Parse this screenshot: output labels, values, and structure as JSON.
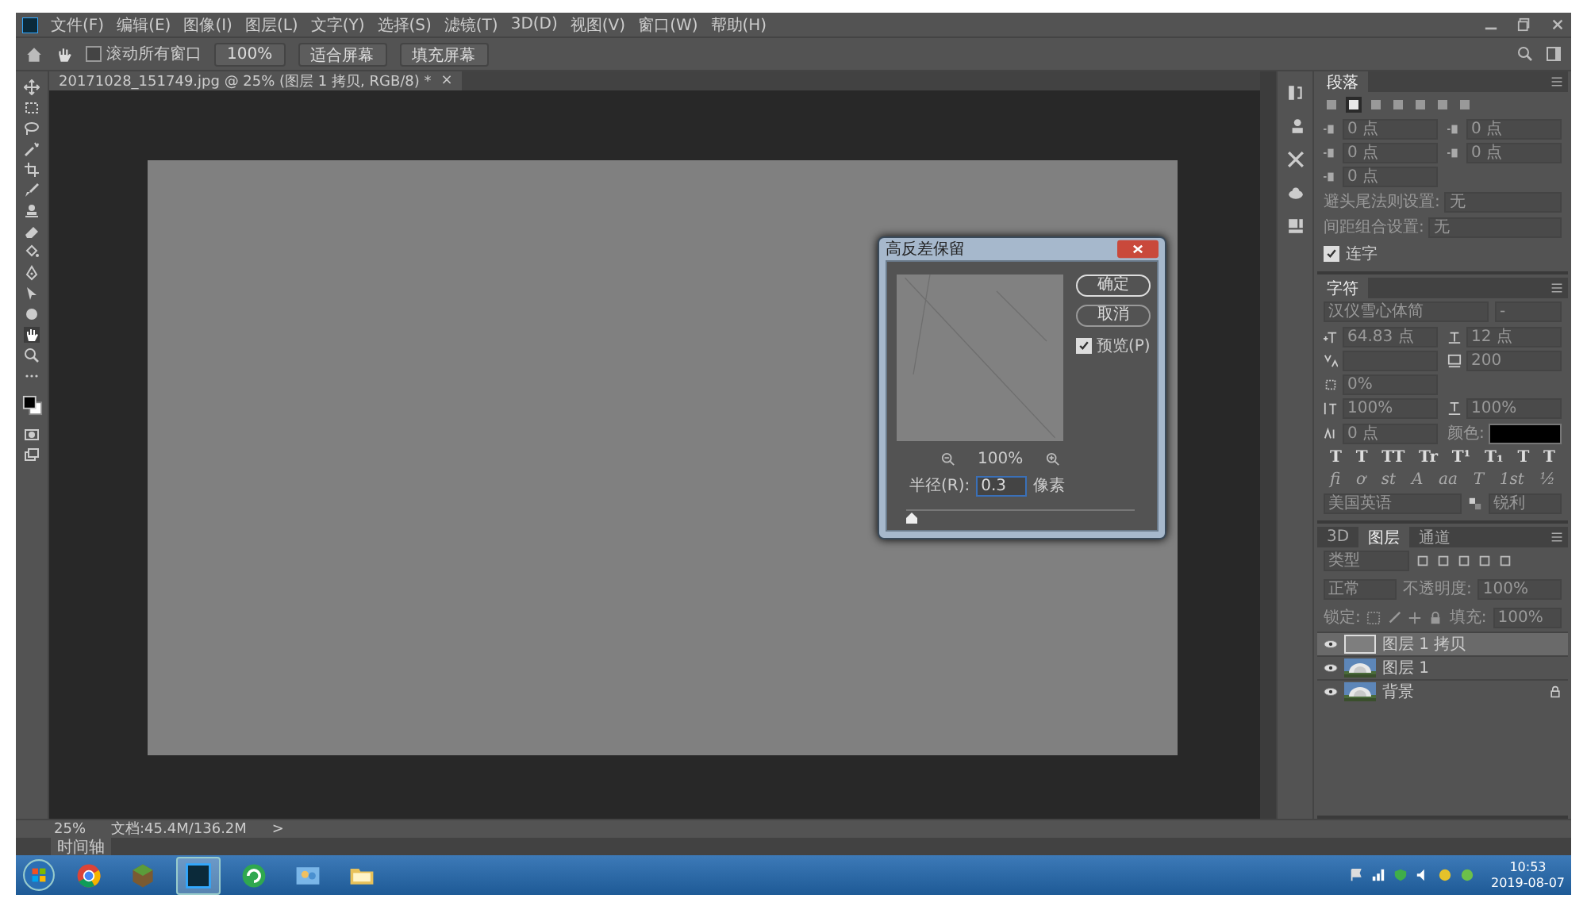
{
  "menu_bar": {
    "items": [
      "文件(F)",
      "编辑(E)",
      "图像(I)",
      "图层(L)",
      "文字(Y)",
      "选择(S)",
      "滤镜(T)",
      "3D(D)",
      "视图(V)",
      "窗口(W)",
      "帮助(H)"
    ]
  },
  "options_bar": {
    "scroll_all": {
      "label": "滚动所有窗口",
      "checked": false
    },
    "buttons": [
      "100%",
      "适合屏幕",
      "填充屏幕"
    ]
  },
  "document_tab": {
    "title": "20171028_151749.jpg @ 25% (图层 1 拷贝, RGB/8) *",
    "close": "×"
  },
  "dialog": {
    "title": "高反差保留",
    "buttons": [
      "确定",
      "取消"
    ],
    "preview": {
      "label": "预览(P)",
      "checked": true
    },
    "zoom": "100%",
    "radius": {
      "label": "半径(R):",
      "value": "0.3",
      "unit": "像素"
    },
    "slider": {
      "level": 0.02
    }
  },
  "paragraph_panel": {
    "tab": "段落",
    "align_buttons": [
      {
        "selected": false
      },
      {
        "selected": true
      },
      {
        "selected": false
      },
      {
        "selected": false
      },
      {
        "selected": false
      },
      {
        "selected": false
      },
      {
        "selected": false
      }
    ],
    "indent_fields": [
      "0 点",
      "0 点",
      "0 点",
      "0 点",
      "0 点"
    ],
    "settings": [
      {
        "label": "避头尾法则设置:",
        "value": "无"
      },
      {
        "label": "间距组合设置:",
        "value": "无"
      }
    ],
    "hyphenate": {
      "label": "连字",
      "checked": true
    }
  },
  "character_panel": {
    "tab": "字符",
    "font": "汉仪雪心体简",
    "style": "-",
    "size": "64.83 点",
    "leading": "12 点",
    "tracking": "200",
    "tsume": "0%",
    "vertical_scale": "100%",
    "horizontal_scale": "100%",
    "baseline_shift": "0 点",
    "color_label": "颜色:",
    "color": "#000000",
    "style_buttons": [
      "T",
      "T",
      "TT",
      "Tr",
      "T¹",
      "T₁",
      "T",
      "T"
    ],
    "opentype_buttons": [
      "fi",
      "ơ",
      "st",
      "A",
      "aa",
      "T",
      "1st",
      "½"
    ],
    "language": "美国英语",
    "antialias": "锐利"
  },
  "layers_panel": {
    "tabs": [
      {
        "label": "3D",
        "selected": false
      },
      {
        "label": "图层",
        "selected": true
      },
      {
        "label": "通道",
        "selected": false
      }
    ],
    "filter": "类型",
    "blend_mode": "正常",
    "opacity_label": "不透明度:",
    "opacity": "100%",
    "lock_label": "锁定:",
    "fill_label": "填充:",
    "fill": "100%",
    "layers": [
      {
        "name": "图层 1 拷贝",
        "kind": "gray",
        "selected": true,
        "visible": true,
        "locked": false
      },
      {
        "name": "图层 1",
        "selected": false,
        "visible": true,
        "locked": false
      },
      {
        "name": "背景",
        "selected": false,
        "visible": true,
        "locked": true
      }
    ]
  },
  "status_bar": {
    "zoom": "25%",
    "doc": "文档:45.4M/136.2M",
    "arrow": ">"
  },
  "timeline": "时间轴",
  "taskbar": {
    "time": "10:53",
    "date": "2019-08-07"
  }
}
